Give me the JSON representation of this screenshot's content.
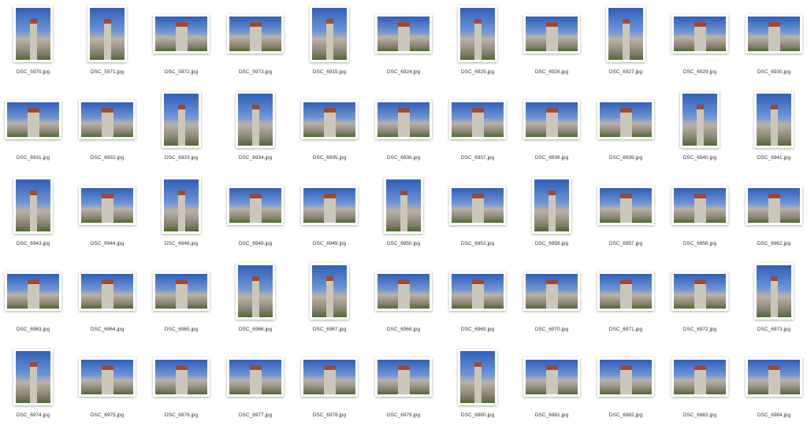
{
  "files": [
    "DSC_5970.jpg",
    "DSC_5971.jpg",
    "DSC_5972.jpg",
    "DSC_5973.jpg",
    "DSC_6915.jpg",
    "DSC_6924.jpg",
    "DSC_6925.jpg",
    "DSC_6926.jpg",
    "DSC_6927.jpg",
    "DSC_6929.jpg",
    "DSC_6930.jpg",
    "DSC_6931.jpg",
    "DSC_6932.jpg",
    "DSC_6933.jpg",
    "DSC_6934.jpg",
    "DSC_6935.jpg",
    "DSC_6936.jpg",
    "DSC_6937.jpg",
    "DSC_6938.jpg",
    "DSC_6939.jpg",
    "DSC_6940.jpg",
    "DSC_6941.jpg",
    "DSC_6943.jpg",
    "DSC_6944.jpg",
    "DSC_6946.jpg",
    "DSC_6948.jpg",
    "DSC_6949.jpg",
    "DSC_6950.jpg",
    "DSC_6953.jpg",
    "DSC_6956.jpg",
    "DSC_6957.jpg",
    "DSC_6958.jpg",
    "DSC_6962.jpg",
    "DSC_6963.jpg",
    "DSC_6964.jpg",
    "DSC_6965.jpg",
    "DSC_6966.jpg",
    "DSC_6967.jpg",
    "DSC_6968.jpg",
    "DSC_6969.jpg",
    "DSC_6970.jpg",
    "DSC_6971.jpg",
    "DSC_6972.jpg",
    "DSC_6973.jpg",
    "DSC_6974.jpg",
    "DSC_6975.jpg",
    "DSC_6976.jpg",
    "DSC_6977.jpg",
    "DSC_6978.jpg",
    "DSC_6979.jpg",
    "DSC_6980.jpg",
    "DSC_6981.jpg",
    "DSC_6982.jpg",
    "DSC_6983.jpg",
    "DSC_6984.jpg"
  ]
}
